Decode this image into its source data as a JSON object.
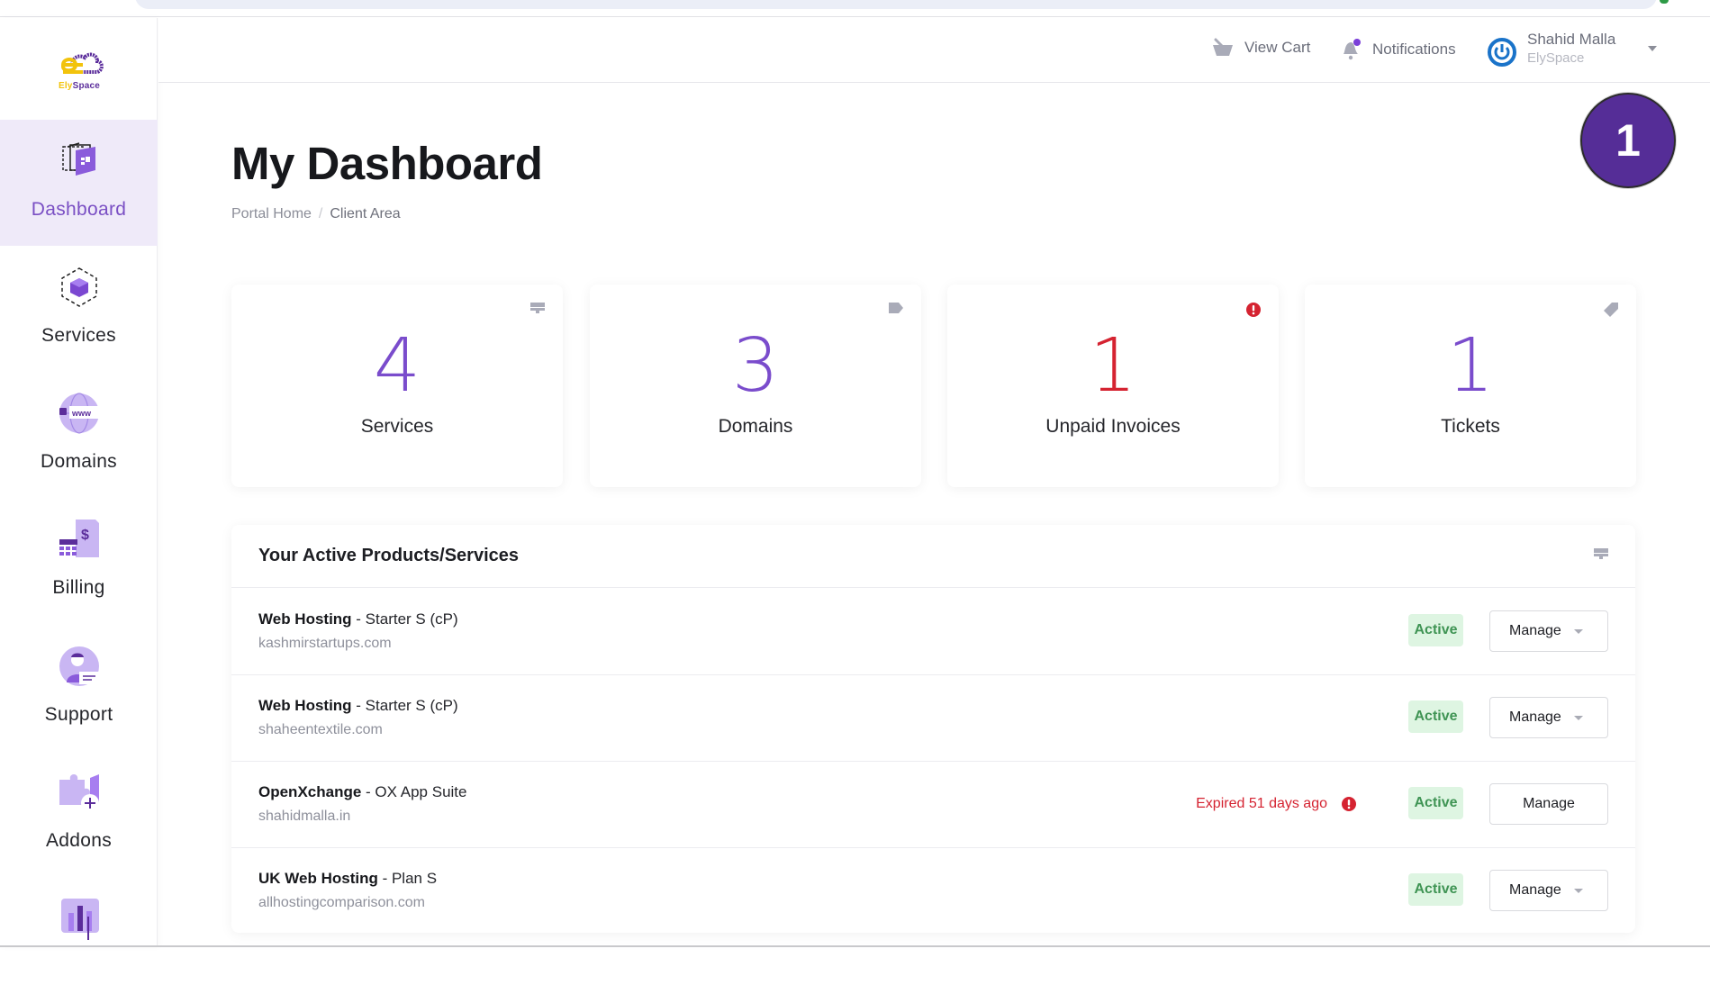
{
  "brand": {
    "name_part1": "Ely",
    "name_part2": "Space",
    "colors": {
      "primary": "#552d97",
      "accent": "#7a4ccc",
      "yellow": "#f2c30c",
      "danger": "#d52331",
      "success": "#3f9454"
    }
  },
  "sidebar": {
    "items": [
      {
        "label": "Dashboard",
        "icon": "dashboard-icon",
        "active": true
      },
      {
        "label": "Services",
        "icon": "services-cube-icon",
        "active": false
      },
      {
        "label": "Domains",
        "icon": "domains-globe-icon",
        "active": false
      },
      {
        "label": "Billing",
        "icon": "billing-invoice-icon",
        "active": false
      },
      {
        "label": "Support",
        "icon": "support-agent-icon",
        "active": false
      },
      {
        "label": "Addons",
        "icon": "addons-puzzle-icon",
        "active": false
      },
      {
        "label": "",
        "icon": "reports-chart-icon",
        "active": false
      }
    ]
  },
  "topbar": {
    "view_cart": "View Cart",
    "notifications": "Notifications",
    "user_name": "Shahid Malla",
    "user_org": "ElySpace"
  },
  "overlay_badge": "1",
  "page": {
    "title": "My Dashboard",
    "breadcrumb": {
      "home": "Portal Home",
      "current": "Client Area"
    }
  },
  "stats": [
    {
      "value": "4",
      "label": "Services",
      "icon": "server-icon",
      "alert": false
    },
    {
      "value": "3",
      "label": "Domains",
      "icon": "tag-icon",
      "alert": false
    },
    {
      "value": "1",
      "label": "Unpaid Invoices",
      "icon": "exclamation-circle-icon",
      "alert": true
    },
    {
      "value": "1",
      "label": "Tickets",
      "icon": "ticket-icon",
      "alert": false
    }
  ],
  "products": {
    "title": "Your Active Products/Services",
    "rows": [
      {
        "product": "Web Hosting",
        "plan": " - Starter S (cP)",
        "domain": "kashmirstartups.com",
        "status": "Active",
        "action": "Manage",
        "expired": "",
        "dropdown": true
      },
      {
        "product": "Web Hosting",
        "plan": " - Starter S (cP)",
        "domain": "shaheentextile.com",
        "status": "Active",
        "action": "Manage",
        "expired": "",
        "dropdown": true
      },
      {
        "product": "OpenXchange",
        "plan": " - OX App Suite",
        "domain": "shahidmalla.in",
        "status": "Active",
        "action": "Manage",
        "expired": "Expired 51 days ago",
        "dropdown": false
      },
      {
        "product": "UK Web Hosting",
        "plan": " - Plan S",
        "domain": "allhostingcomparison.com",
        "status": "Active",
        "action": "Manage",
        "expired": "",
        "dropdown": true
      }
    ]
  }
}
